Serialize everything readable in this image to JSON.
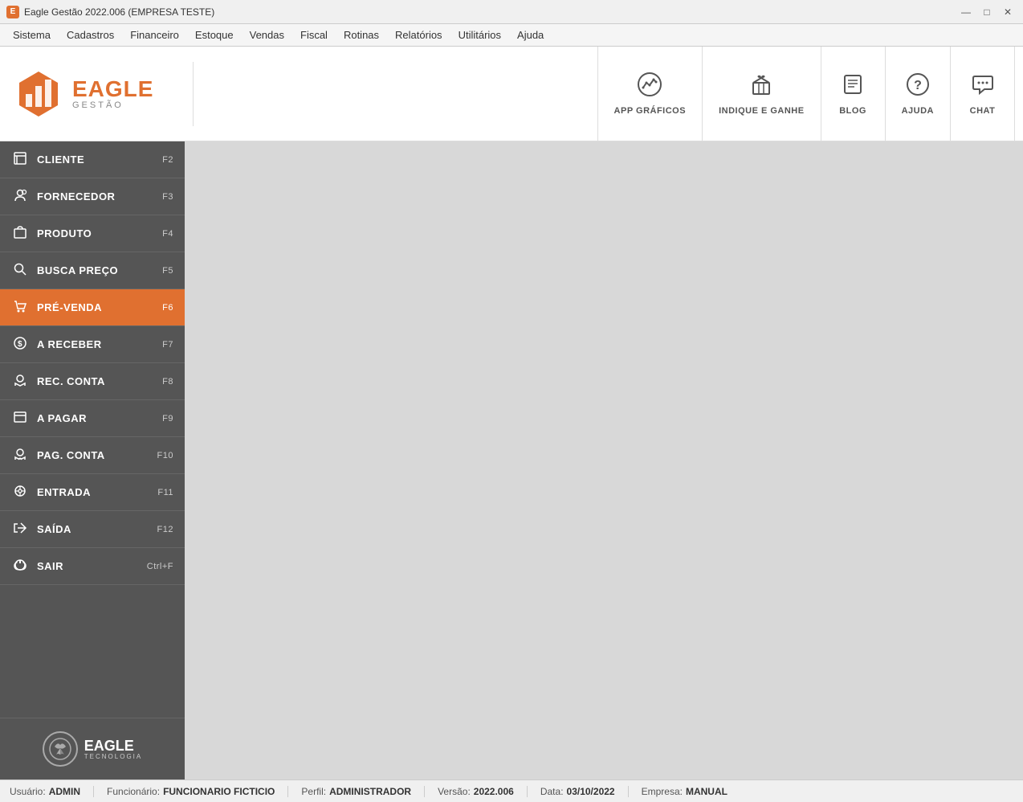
{
  "titlebar": {
    "title": "Eagle Gestão 2022.006 (EMPRESA TESTE)",
    "minimize": "—",
    "maximize": "□",
    "close": "✕"
  },
  "menubar": {
    "items": [
      "Sistema",
      "Cadastros",
      "Financeiro",
      "Estoque",
      "Vendas",
      "Fiscal",
      "Rotinas",
      "Relatórios",
      "Utilitários",
      "Ajuda"
    ]
  },
  "header": {
    "logo": {
      "name": "EAGLE",
      "subtitle": "GESTÃO"
    },
    "nav": [
      {
        "id": "app-graficos",
        "icon": "📊",
        "label": "APP GRÁFICOS"
      },
      {
        "id": "indique-ganhe",
        "icon": "🎁",
        "label": "INDIQUE E GANHE"
      },
      {
        "id": "blog",
        "icon": "📋",
        "label": "BLOG"
      },
      {
        "id": "ajuda",
        "icon": "❓",
        "label": "AJUDA"
      },
      {
        "id": "chat",
        "icon": "💬",
        "label": "CHAT"
      }
    ]
  },
  "sidebar": {
    "items": [
      {
        "id": "cliente",
        "label": "CLIENTE",
        "shortcut": "F2",
        "active": false
      },
      {
        "id": "fornecedor",
        "label": "FORNECEDOR",
        "shortcut": "F3",
        "active": false
      },
      {
        "id": "produto",
        "label": "PRODUTO",
        "shortcut": "F4",
        "active": false
      },
      {
        "id": "busca-preco",
        "label": "BUSCA PREÇO",
        "shortcut": "F5",
        "active": false
      },
      {
        "id": "pre-venda",
        "label": "PRÉ-VENDA",
        "shortcut": "F6",
        "active": true
      },
      {
        "id": "a-receber",
        "label": "A RECEBER",
        "shortcut": "F7",
        "active": false
      },
      {
        "id": "rec-conta",
        "label": "REC. CONTA",
        "shortcut": "F8",
        "active": false
      },
      {
        "id": "a-pagar",
        "label": "A PAGAR",
        "shortcut": "F9",
        "active": false
      },
      {
        "id": "pag-conta",
        "label": "PAG. CONTA",
        "shortcut": "F10",
        "active": false
      },
      {
        "id": "entrada",
        "label": "ENTRADA",
        "shortcut": "F11",
        "active": false
      },
      {
        "id": "saida",
        "label": "SAÍDA",
        "shortcut": "F12",
        "active": false
      },
      {
        "id": "sair",
        "label": "SAIR",
        "shortcut": "Ctrl+F",
        "active": false
      }
    ],
    "footer": {
      "brand": "EAGLE",
      "sub": "TECNOLOGIA"
    }
  },
  "statusbar": {
    "usuario_label": "Usuário:",
    "usuario_value": "ADMIN",
    "funcionario_label": "Funcionário:",
    "funcionario_value": "FUNCIONARIO FICTICIO",
    "perfil_label": "Perfil:",
    "perfil_value": "ADMINISTRADOR",
    "versao_label": "Versão:",
    "versao_value": "2022.006",
    "data_label": "Data:",
    "data_value": "03/10/2022",
    "empresa_label": "Empresa:",
    "empresa_value": "MANUAL"
  }
}
